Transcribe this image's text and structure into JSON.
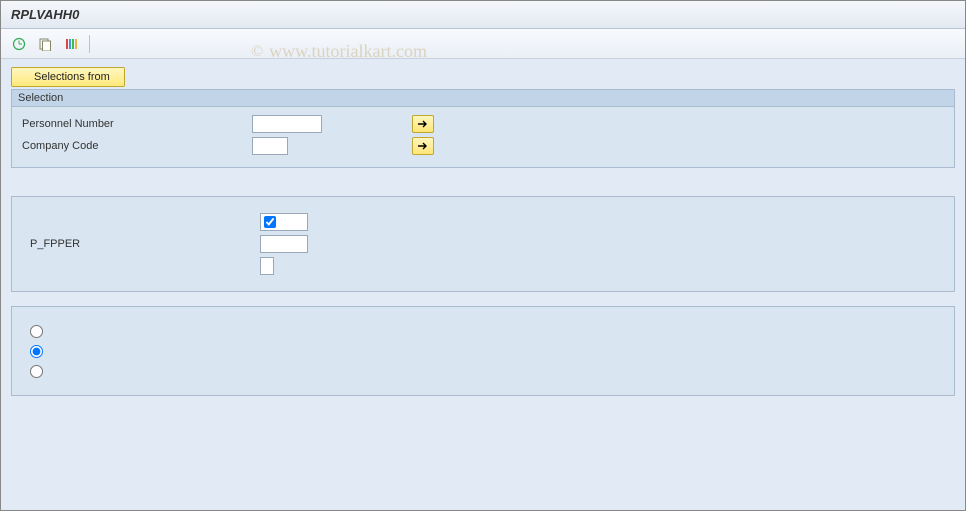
{
  "title": "RPLVAHH0",
  "watermark": "© www.tutorialkart.com",
  "toolbar": {
    "icons": [
      "execute-icon",
      "variant-icon",
      "variant-overview-icon"
    ]
  },
  "buttons": {
    "selections_from": "Selections from"
  },
  "selection_group": {
    "title": "Selection",
    "rows": [
      {
        "label": "Personnel Number",
        "value": "",
        "has_more": true
      },
      {
        "label": "Company Code",
        "value": "",
        "has_more": true
      }
    ]
  },
  "params_group": {
    "checkbox_value": true,
    "rows": [
      {
        "label": "",
        "type": "checkbox"
      },
      {
        "label": "P_FPPER",
        "type": "text",
        "value": ""
      },
      {
        "label": "",
        "type": "tiny",
        "value": ""
      }
    ]
  },
  "radio_group": {
    "options": [
      {
        "value": "opt1",
        "label": "",
        "checked": false
      },
      {
        "value": "opt2",
        "label": "",
        "checked": true
      },
      {
        "value": "opt3",
        "label": "",
        "checked": false
      }
    ]
  }
}
